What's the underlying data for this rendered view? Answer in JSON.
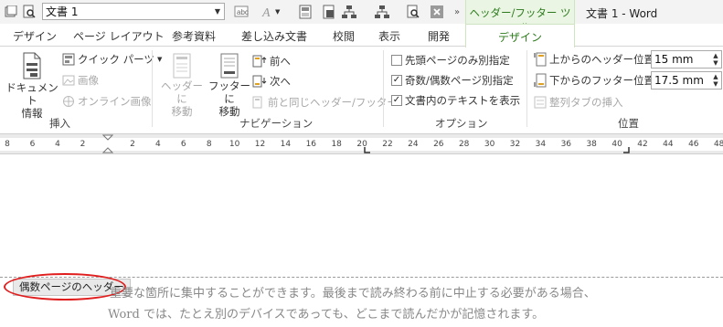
{
  "qat": {
    "doc_name": "文書 1",
    "context_tab_group": "ヘッダー/フッター ツール",
    "window_title": "文書 1 - Word"
  },
  "tabs": [
    "デザイン",
    "ページ レイアウト",
    "参考資料",
    "差し込み文書",
    "校閲",
    "表示",
    "開発"
  ],
  "active_tab": "デザイン",
  "ribbon": {
    "insert_group": {
      "label": "挿入",
      "document_info": "ドキュメント\n情報",
      "quick_parts": "クイック パーツ",
      "picture": "画像",
      "online_picture": "オンライン画像"
    },
    "navigation_group": {
      "label": "ナビゲーション",
      "goto_header": "ヘッダーに\n移動",
      "goto_footer": "フッターに\n移動",
      "previous": "前へ",
      "next": "次へ",
      "link_to_previous": "前と同じヘッダー/フッター"
    },
    "options_group": {
      "label": "オプション",
      "different_first_page": "先頭ページのみ別指定",
      "different_odd_even": "奇数/偶数ページ別指定",
      "show_document_text": "文書内のテキストを表示"
    },
    "position_group": {
      "label": "位置",
      "header_from_top_label": "上からのヘッダー位置:",
      "header_from_top_value": "15 mm",
      "footer_from_bottom_label": "下からのフッター位置:",
      "footer_from_bottom_value": "17.5 mm",
      "insert_alignment_tab": "整列タブの挿入"
    }
  },
  "ruler": {
    "labels": [
      "8",
      "6",
      "4",
      "2",
      "2",
      "4",
      "6",
      "8",
      "10",
      "12",
      "14",
      "16",
      "18",
      "20",
      "22",
      "24",
      "26",
      "28",
      "30",
      "32",
      "34",
      "36",
      "38",
      "40",
      "42",
      "44",
      "46",
      "48"
    ]
  },
  "document": {
    "header_tag": "偶数ページのヘッダー",
    "line1": "重要な箇所に集中することができます。最後まで読み終わる前に中止する必要がある場合、",
    "line2": "Word  では、たとえ別のデバイスであっても、どこまで読んだかが記憶されます。"
  },
  "colors": {
    "context_green": "#2c7a1c",
    "highlight_red": "#e01e1e"
  }
}
